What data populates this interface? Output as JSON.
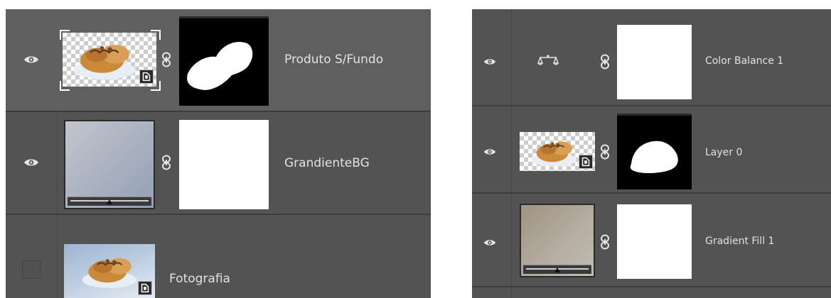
{
  "left_panel": {
    "layers": [
      {
        "name": "Produto S/Fundo",
        "visible": true,
        "selected": true,
        "icon": "smart-object-icon",
        "mask": "subject-mask"
      },
      {
        "name": "GrandienteBG",
        "visible": true,
        "selected": false,
        "icon": "gradient-fill-thumbnail",
        "mask": "white-mask"
      },
      {
        "name": "Fotografia",
        "visible": false,
        "selected": false,
        "icon": "smart-object-icon"
      }
    ]
  },
  "right_panel": {
    "layers": [
      {
        "name": "Color Balance 1",
        "visible": true,
        "icon": "color-balance-icon",
        "mask": "white-mask"
      },
      {
        "name": "Layer 0",
        "visible": true,
        "icon": "smart-object-icon",
        "mask": "subject-mask"
      },
      {
        "name": "Gradient Fill 1",
        "visible": true,
        "icon": "gradient-fill-thumbnail",
        "mask": "white-mask"
      }
    ]
  },
  "colors": {
    "panel_bg": "#535353",
    "selected_row_bg": "#5f5f5f",
    "text": "#e2e2e2",
    "separator": "#3d3d3d"
  }
}
